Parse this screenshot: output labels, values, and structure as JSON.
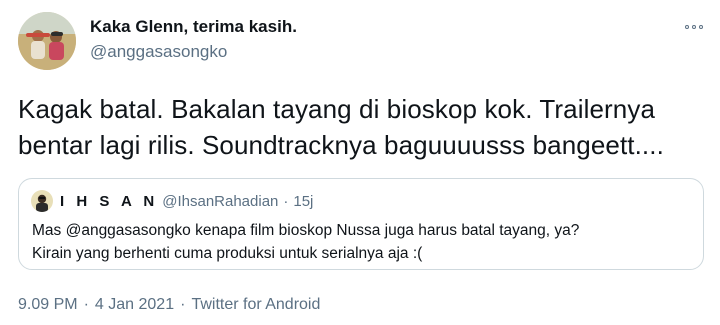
{
  "author": {
    "display_name": "Kaka Glenn, terima kasih.",
    "handle": "@anggasasongko"
  },
  "tweet": {
    "line1": "Kagak batal. Bakalan tayang di bioskop kok. Trailernya",
    "line2": "bentar lagi rilis. Soundtracknya baguuuusss bangeett...."
  },
  "quoted": {
    "name": "I H S A N",
    "handle": "@IhsanRahadian",
    "separator": "·",
    "time": "15j",
    "line1": "Mas @anggasasongko kenapa film bioskop Nussa juga harus batal tayang, ya?",
    "line2": "Kirain yang berhenti cuma produksi untuk serialnya aja :("
  },
  "meta": {
    "time": "9.09 PM",
    "date": "4 Jan 2021",
    "source": "Twitter for Android",
    "separator": "·"
  },
  "colors": {
    "text": "#0f1419",
    "secondary": "#5b7083",
    "border": "#cfd9de"
  },
  "icons": {
    "more": "more-horizontal-icon"
  }
}
